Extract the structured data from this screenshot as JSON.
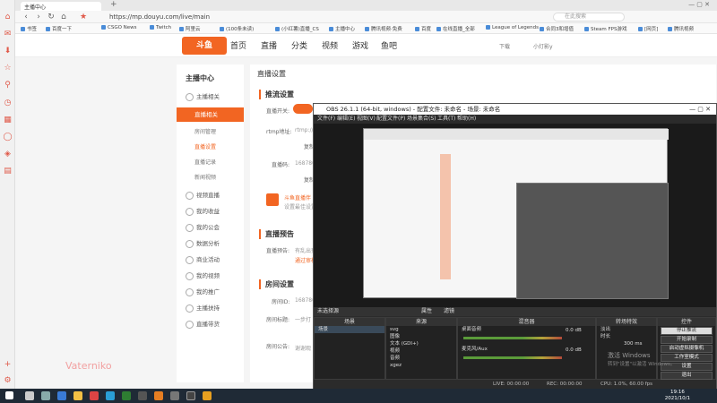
{
  "browser": {
    "tabs": [
      "主播中心",
      "腾讯视频·免费...",
      "(100条未读)",
      "(小红薯)..."
    ],
    "url": "https://mp.douyu.com/live/main",
    "search_placeholder": "在此搜索",
    "bookmarks": [
      "书签",
      "百度一下",
      "CSGO News",
      "Twitch",
      "阿里云",
      "(100条未读)",
      "(小红薯)直播_CS",
      "主播中心",
      "腾讯视频·免费",
      "百度",
      "在线直播_全部",
      "League of Legends",
      "合同3和增值",
      "Steam FPS游戏",
      "[网页]",
      "腾讯视频"
    ]
  },
  "douyu": {
    "logo": "斗鱼",
    "nav": [
      "首页",
      "直播",
      "分类",
      "视频",
      "游戏",
      "鱼吧"
    ],
    "header_right": [
      "下载",
      "小灯影y"
    ],
    "side_title": "主播中心",
    "menu": [
      {
        "label": "主播相关"
      },
      {
        "label": "直播相关"
      },
      {
        "label": "房间管理"
      },
      {
        "label": "直播设置"
      },
      {
        "label": "直播记录"
      },
      {
        "label": "新闻视频"
      },
      {
        "label": "视频直播"
      },
      {
        "label": "我的收益"
      },
      {
        "label": "我的公会"
      },
      {
        "label": "数据分析"
      },
      {
        "label": "商业活动"
      },
      {
        "label": "我的视频"
      },
      {
        "label": "我的推广"
      },
      {
        "label": "主播扶持"
      },
      {
        "label": "直播带货"
      }
    ],
    "panel_title": "直播设置",
    "sections": {
      "push": "推流设置",
      "preview": "直播预告",
      "room": "房间设置"
    },
    "fields": {
      "live_switch": "直播开关:",
      "rtmp_label": "rtmp地址:",
      "rtmp_value": "rtmp://sen...",
      "copy": "复制",
      "stream_code": "直播码:",
      "stream_value": "168780...",
      "tool_title": "斗鱼直播伴",
      "tool_desc": "设置最佳设置",
      "preview_label": "直播预告:",
      "preview_value": "有乱出预",
      "preview_link": "通过审核",
      "room_id": "房间ID:",
      "room_id_value": "1687800",
      "room_title": "房间标题:",
      "room_title_value": "一步打",
      "room_notice": "房间公告:",
      "room_notice_value": "谢谢观"
    },
    "watermark": "Vaterniko"
  },
  "obs": {
    "title": "OBS 26.1.1 (64-bit, windows) - 配置文件: 未命名 - 场景: 未命名",
    "menu": [
      "文件(F)",
      "编辑(E)",
      "视图(V)",
      "配置文件(P)",
      "场景集合(S)",
      "工具(T)",
      "帮助(H)"
    ],
    "scene_label": "未选择源",
    "props": "属性",
    "filters": "滤镜",
    "docks": {
      "scenes_title": "场景",
      "scenes": [
        "场景"
      ],
      "sources_title": "来源",
      "sources": [
        "svg",
        "图像",
        "文本 (GDI+)",
        "视频",
        "音频",
        "xgez"
      ],
      "mixer_title": "混音器",
      "mixer": [
        {
          "name": "桌面音频",
          "value": "0.0 dB"
        },
        {
          "name": "麦克风/Aux",
          "value": "0.0 dB"
        }
      ],
      "transitions_title": "转场特效",
      "transition": "淡出",
      "duration_label": "时长",
      "duration": "300 ms",
      "controls_title": "控件",
      "controls": [
        "停止推流",
        "开始录制",
        "启动虚拟摄像机",
        "工作室模式",
        "设置",
        "退出"
      ]
    },
    "status": {
      "live": "LIVE: 00:00:00",
      "rec": "REC: 00:00:00",
      "cpu": "CPU: 1.0%, 60.00 fps"
    },
    "activate_title": "激活 Windows",
    "activate_desc": "转到\"设置\"以激活 Windows。"
  },
  "taskbar": {
    "time": "19:16",
    "date": "2021/10/1"
  }
}
